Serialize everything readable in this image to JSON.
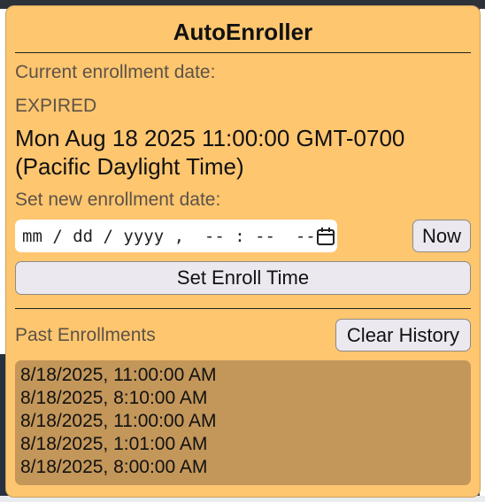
{
  "app": {
    "title": "AutoEnroller"
  },
  "current": {
    "label": "Current enrollment date:",
    "status": "EXPIRED",
    "date_line1": "Mon Aug 18 2025 11:00:00 GMT-0700",
    "date_line2": "(Pacific Daylight Time)"
  },
  "set_new": {
    "label": "Set new enrollment date:",
    "input_display": "mm / dd / yyyy ,  -- : --  --",
    "now_label": "Now",
    "set_label": "Set Enroll Time"
  },
  "past": {
    "label": "Past Enrollments",
    "clear_label": "Clear History",
    "items": [
      "8/18/2025, 11:00:00 AM",
      "8/18/2025, 8:10:00 AM",
      "8/18/2025, 11:00:00 AM",
      "8/18/2025, 1:01:00 AM",
      "8/18/2025, 8:00:00 AM"
    ]
  },
  "colors": {
    "popup_bg": "#ffc670",
    "history_bg": "#c3965a",
    "muted_text": "#5c5346",
    "button_bg": "#ebe8ef"
  },
  "icons": {
    "date_picker": "calendar-icon"
  }
}
